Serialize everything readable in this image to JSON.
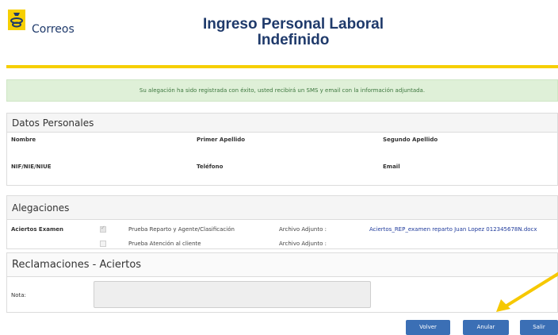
{
  "header": {
    "brand": "Correos",
    "title_line1": "Ingreso Personal Laboral",
    "title_line2": "Indefinido"
  },
  "alert": {
    "message": "Su alegación ha sido registrada con éxito, usted recibirá un SMS y email con la información adjuntada."
  },
  "datos_personales": {
    "heading": "Datos Personales",
    "nombre": "Nombre",
    "primer_apellido": "Primer Apellido",
    "segundo_apellido": "Segundo Apellido",
    "nif": "NIF/NIE/NIUE",
    "telefono": "Teléfono",
    "email": "Email"
  },
  "alegaciones": {
    "heading": "Alegaciones",
    "row_label": "Aciertos Examen",
    "items": [
      {
        "checked": true,
        "label": "Prueba Reparto y Agente/Clasificación",
        "archivo_label": "Archivo Adjunto :",
        "file": "Aciertos_REP_examen reparto Juan Lopez 012345678N.docx"
      },
      {
        "checked": false,
        "label": "Prueba Atención al cliente",
        "archivo_label": "Archivo Adjunto :",
        "file": ""
      }
    ]
  },
  "reclamaciones": {
    "heading": "Reclamaciones - Aciertos",
    "nota_label": "Nota:"
  },
  "buttons": {
    "volver": "Volver",
    "anular": "Anular",
    "salir": "Salir"
  },
  "colors": {
    "brand_yellow": "#f6cf02",
    "brand_blue": "#1f3a6b",
    "button_blue": "#3b6fb5",
    "alert_green": "#dff0d8"
  }
}
